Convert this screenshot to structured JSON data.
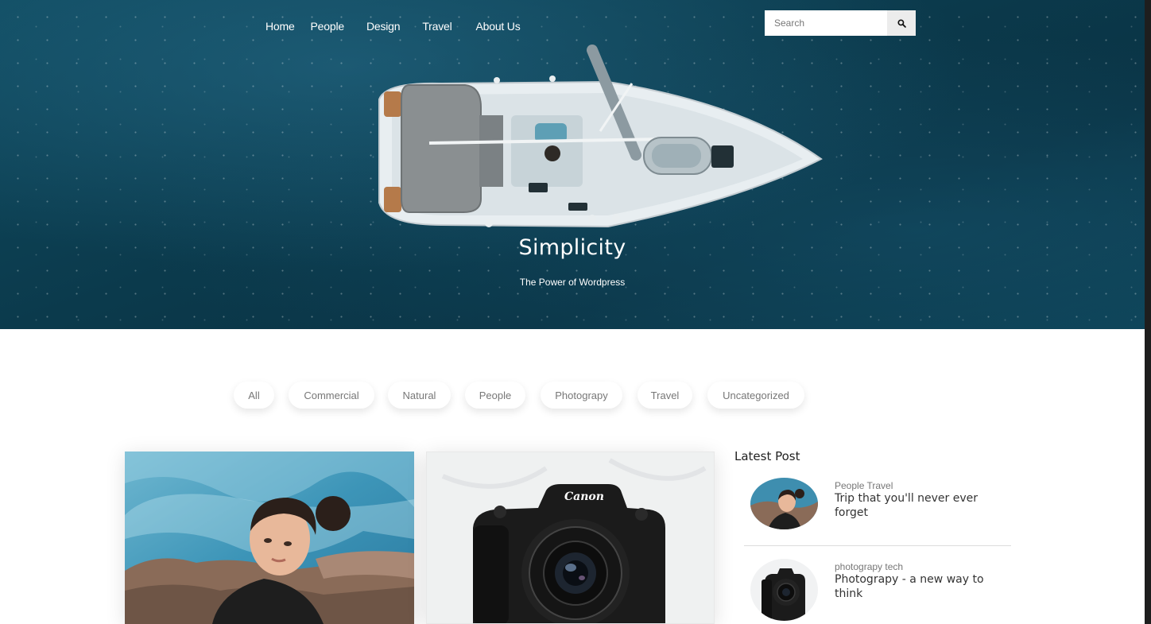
{
  "nav": {
    "items": [
      {
        "label": "Home"
      },
      {
        "label": "People"
      },
      {
        "label": "Design"
      },
      {
        "label": "Travel"
      },
      {
        "label": "About Us"
      }
    ]
  },
  "search": {
    "placeholder": "Search",
    "icon": "search-icon"
  },
  "hero": {
    "title": "Simplicity",
    "subtitle": "The Power of Wordpress"
  },
  "filters": [
    {
      "label": "All"
    },
    {
      "label": "Commercial"
    },
    {
      "label": "Natural"
    },
    {
      "label": "People"
    },
    {
      "label": "Photograpy"
    },
    {
      "label": "Travel"
    },
    {
      "label": "Uncategorized"
    }
  ],
  "camera": {
    "brand": "Canon"
  },
  "sidebar": {
    "title": "Latest Post",
    "posts": [
      {
        "category": "People Travel",
        "title": "Trip that you'll never ever forget"
      },
      {
        "category": "photograpy tech",
        "title": "Photograpy - a new way to think"
      }
    ]
  },
  "colors": {
    "hero_sea": "#0b3a4c",
    "pill_text": "#777777",
    "heading_text": "#222222"
  }
}
